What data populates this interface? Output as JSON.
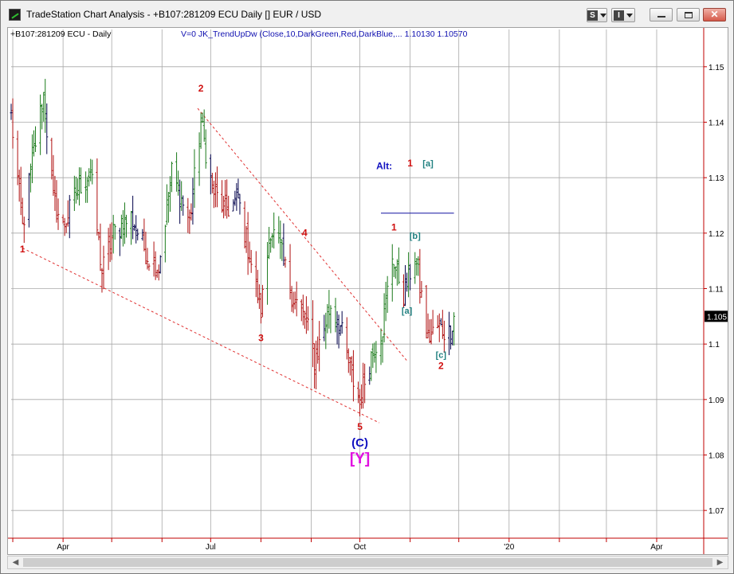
{
  "window": {
    "title": "TradeStation Chart Analysis - +B107:281209 ECU Daily [] EUR / USD",
    "buttons": {
      "s_label": "S",
      "i_label": "I",
      "close_label": "✕"
    }
  },
  "chart_header": {
    "symbol_label": "+B107:281209 ECU - Daily",
    "indicator_label": "V=0  JK_TrendUpDw  (Close,10,DarkGreen,Red,DarkBlue,...   1.10130   1.10570"
  },
  "last_price_label": "1.105",
  "colors": {
    "up": "#1a7a1a",
    "down": "#b01010",
    "neutral": "#00004a",
    "wave_red": "#d01010",
    "wave_teal": "#208080",
    "wave_blue": "#1010c0",
    "wave_magenta": "#e010e0",
    "trendline": "#e03030",
    "grid": "#a8a8a8",
    "axis_text": "#c00000"
  },
  "chart_data": {
    "type": "ohlc",
    "title": "EUR / USD Daily",
    "xlabel": "",
    "ylabel": "",
    "ylim": [
      1.065,
      1.155
    ],
    "y_ticks": [
      1.07,
      1.08,
      1.09,
      1.1,
      1.11,
      1.12,
      1.13,
      1.14,
      1.15
    ],
    "y_tick_labels": [
      "1.07",
      "1.08",
      "1.09",
      "1.1",
      "1.1",
      "1.11",
      "1.12",
      "1.13",
      "1.14",
      "1.15"
    ],
    "x_tick_labels": [
      "Apr",
      "Jul",
      "Oct",
      "'20",
      "Apr"
    ],
    "x_tick_dates": [
      "2019-04-01",
      "2019-07-01",
      "2019-10-01",
      "2020-01-01",
      "2020-04-01"
    ],
    "x_range": [
      "2019-02-28",
      "2020-04-30"
    ],
    "grid": true,
    "anchors": [
      [
        "2019-02-28",
        1.141
      ],
      [
        "2019-03-07",
        1.121
      ],
      [
        "2019-03-13",
        1.133
      ],
      [
        "2019-03-20",
        1.145
      ],
      [
        "2019-03-26",
        1.126
      ],
      [
        "2019-04-01",
        1.121
      ],
      [
        "2019-04-10",
        1.128
      ],
      [
        "2019-04-18",
        1.131
      ],
      [
        "2019-04-25",
        1.113
      ],
      [
        "2019-05-02",
        1.12
      ],
      [
        "2019-05-13",
        1.123
      ],
      [
        "2019-05-23",
        1.116
      ],
      [
        "2019-05-30",
        1.114
      ],
      [
        "2019-06-07",
        1.131
      ],
      [
        "2019-06-18",
        1.122
      ],
      [
        "2019-06-25",
        1.14
      ],
      [
        "2019-07-02",
        1.128
      ],
      [
        "2019-07-10",
        1.124
      ],
      [
        "2019-07-18",
        1.126
      ],
      [
        "2019-07-25",
        1.116
      ],
      [
        "2019-08-01",
        1.106
      ],
      [
        "2019-08-07",
        1.121
      ],
      [
        "2019-08-13",
        1.117
      ],
      [
        "2019-08-20",
        1.109
      ],
      [
        "2019-08-29",
        1.104
      ],
      [
        "2019-09-03",
        1.097
      ],
      [
        "2019-09-13",
        1.107
      ],
      [
        "2019-09-19",
        1.103
      ],
      [
        "2019-09-26",
        1.094
      ],
      [
        "2019-10-01",
        1.09
      ],
      [
        "2019-10-08",
        1.098
      ],
      [
        "2019-10-15",
        1.103
      ],
      [
        "2019-10-21",
        1.116
      ],
      [
        "2019-10-28",
        1.109
      ],
      [
        "2019-11-04",
        1.116
      ],
      [
        "2019-11-12",
        1.101
      ],
      [
        "2019-11-18",
        1.103
      ],
      [
        "2019-11-25",
        1.102
      ],
      [
        "2019-11-28",
        1.105
      ]
    ],
    "annotations": [
      {
        "text": "1",
        "date": "2019-03-07",
        "y": 1.1165,
        "style": "red"
      },
      {
        "text": "2",
        "date": "2019-06-25",
        "y": 1.1455,
        "style": "red"
      },
      {
        "text": "3",
        "date": "2019-08-01",
        "y": 1.1005,
        "style": "red"
      },
      {
        "text": "4",
        "date": "2019-08-28",
        "y": 1.1195,
        "style": "red"
      },
      {
        "text": "5",
        "date": "2019-10-01",
        "y": 1.0845,
        "style": "red"
      },
      {
        "text": "(C)",
        "date": "2019-10-01",
        "y": 1.0815,
        "style": "blue"
      },
      {
        "text": "[Y]",
        "date": "2019-10-01",
        "y": 1.0785,
        "style": "magenta"
      },
      {
        "text": "1",
        "date": "2019-10-22",
        "y": 1.1205,
        "style": "red"
      },
      {
        "text": "[b]",
        "date": "2019-11-04",
        "y": 1.119,
        "style": "teal"
      },
      {
        "text": "[a]",
        "date": "2019-10-30",
        "y": 1.1055,
        "style": "teal"
      },
      {
        "text": "[c]",
        "date": "2019-11-20",
        "y": 1.0975,
        "style": "teal"
      },
      {
        "text": "2",
        "date": "2019-11-20",
        "y": 1.0955,
        "style": "red"
      },
      {
        "text": "Alt:",
        "date": "2019-10-16",
        "y": 1.1315,
        "style": "blue"
      },
      {
        "text": "1",
        "date": "2019-11-01",
        "y": 1.132,
        "style": "red"
      },
      {
        "text": "[a]",
        "date": "2019-11-12",
        "y": 1.132,
        "style": "teal"
      }
    ],
    "trendlines": [
      {
        "from": [
          "2019-03-07",
          1.1173
        ],
        "to": [
          "2019-10-13",
          1.0858
        ]
      },
      {
        "from": [
          "2019-06-23",
          1.1425
        ],
        "to": [
          "2019-10-30",
          1.097
        ]
      }
    ],
    "alt_underline": {
      "from": [
        "2019-10-14",
        1.1236
      ],
      "to": [
        "2019-11-28",
        1.1236
      ]
    }
  }
}
